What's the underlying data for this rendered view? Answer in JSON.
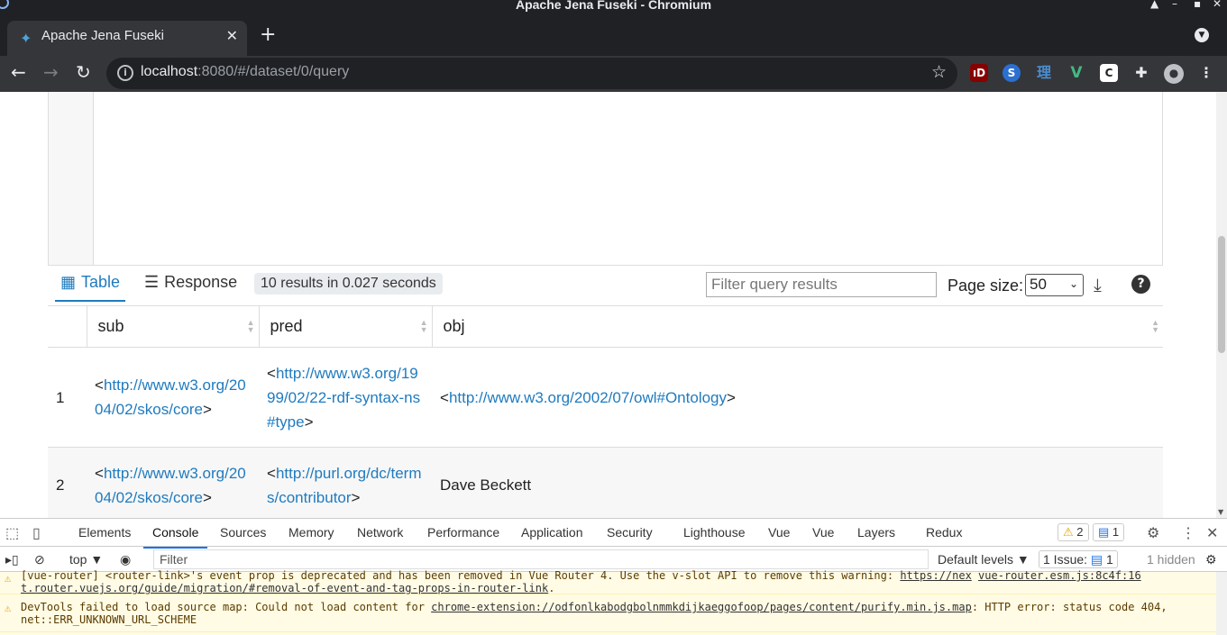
{
  "window": {
    "title": "Apache Jena Fuseki - Chromium",
    "controls": [
      "▲",
      "–",
      "▪",
      "✕"
    ]
  },
  "browser": {
    "tab_title": "Apache Jena Fuseki",
    "tab_close": "✕",
    "new_tab": "+",
    "url_host": "localhost",
    "url_rest": ":8080/#/dataset/0/query",
    "extensions": [
      "uBlock",
      "S",
      "理",
      "V",
      "C",
      "puzzle"
    ]
  },
  "results_bar": {
    "tab_table": "Table",
    "tab_response": "Response",
    "summary": "10 results in 0.027 seconds",
    "filter_placeholder": "Filter query results",
    "page_size_label": "Page size:",
    "page_size_value": "50"
  },
  "table": {
    "columns": [
      "sub",
      "pred",
      "obj"
    ],
    "rows": [
      {
        "index": "1",
        "sub_pre": "<",
        "sub_link": "http://www.w3.org/2004/02/skos/core",
        "sub_post": ">",
        "pred_pre": "<",
        "pred_link": "http://www.w3.org/1999/02/22-rdf-syntax-ns#type",
        "pred_post": ">",
        "obj_pre": "<",
        "obj_link": "http://www.w3.org/2002/07/owl#Ontology",
        "obj_post": ">"
      },
      {
        "index": "2",
        "sub_pre": "<",
        "sub_link": "http://www.w3.org/2004/02/skos/core",
        "sub_post": ">",
        "pred_pre": "<",
        "pred_link": "http://purl.org/dc/terms/contributor",
        "pred_post": ">",
        "obj_text": "Dave Beckett"
      }
    ]
  },
  "devtools": {
    "tabs": [
      "Elements",
      "Console",
      "Sources",
      "Memory",
      "Network",
      "Performance",
      "Application",
      "Security",
      "Lighthouse",
      "Vue",
      "Vue",
      "Layers",
      "Redux"
    ],
    "active_tab": "Console",
    "warning_count": "2",
    "message_count": "1",
    "context": "top ▼",
    "filter_placeholder": "Filter",
    "levels": "Default levels ▼",
    "issues_label": "1 Issue:",
    "issues_count": "1",
    "hidden": "1 hidden",
    "messages": [
      {
        "text_a": "[vue-router] <router-link>'s event prop is deprecated and has been removed in Vue Router 4. Use the v-slot API to remove this warning: ",
        "link_a": "https://nex",
        "source": "vue-router.esm.js:8c4f:16",
        "link_b": "t.router.vuejs.org/guide/migration/#removal-of-event-and-tag-props-in-router-link",
        "tail": "."
      },
      {
        "text_a": "DevTools failed to load source map: Could not load content for ",
        "link_a": "chrome-extension://odfonlkabodgbolnmmkdijkaeggofoop/pages/content/purify.min.js.map",
        "text_b": ": HTTP error: status code 404, net::ERR_UNKNOWN_URL_SCHEME"
      }
    ]
  },
  "colors": {
    "accent": "#1f7bbf",
    "warning": "#e8a200",
    "chrome_dark": "#35363a"
  }
}
